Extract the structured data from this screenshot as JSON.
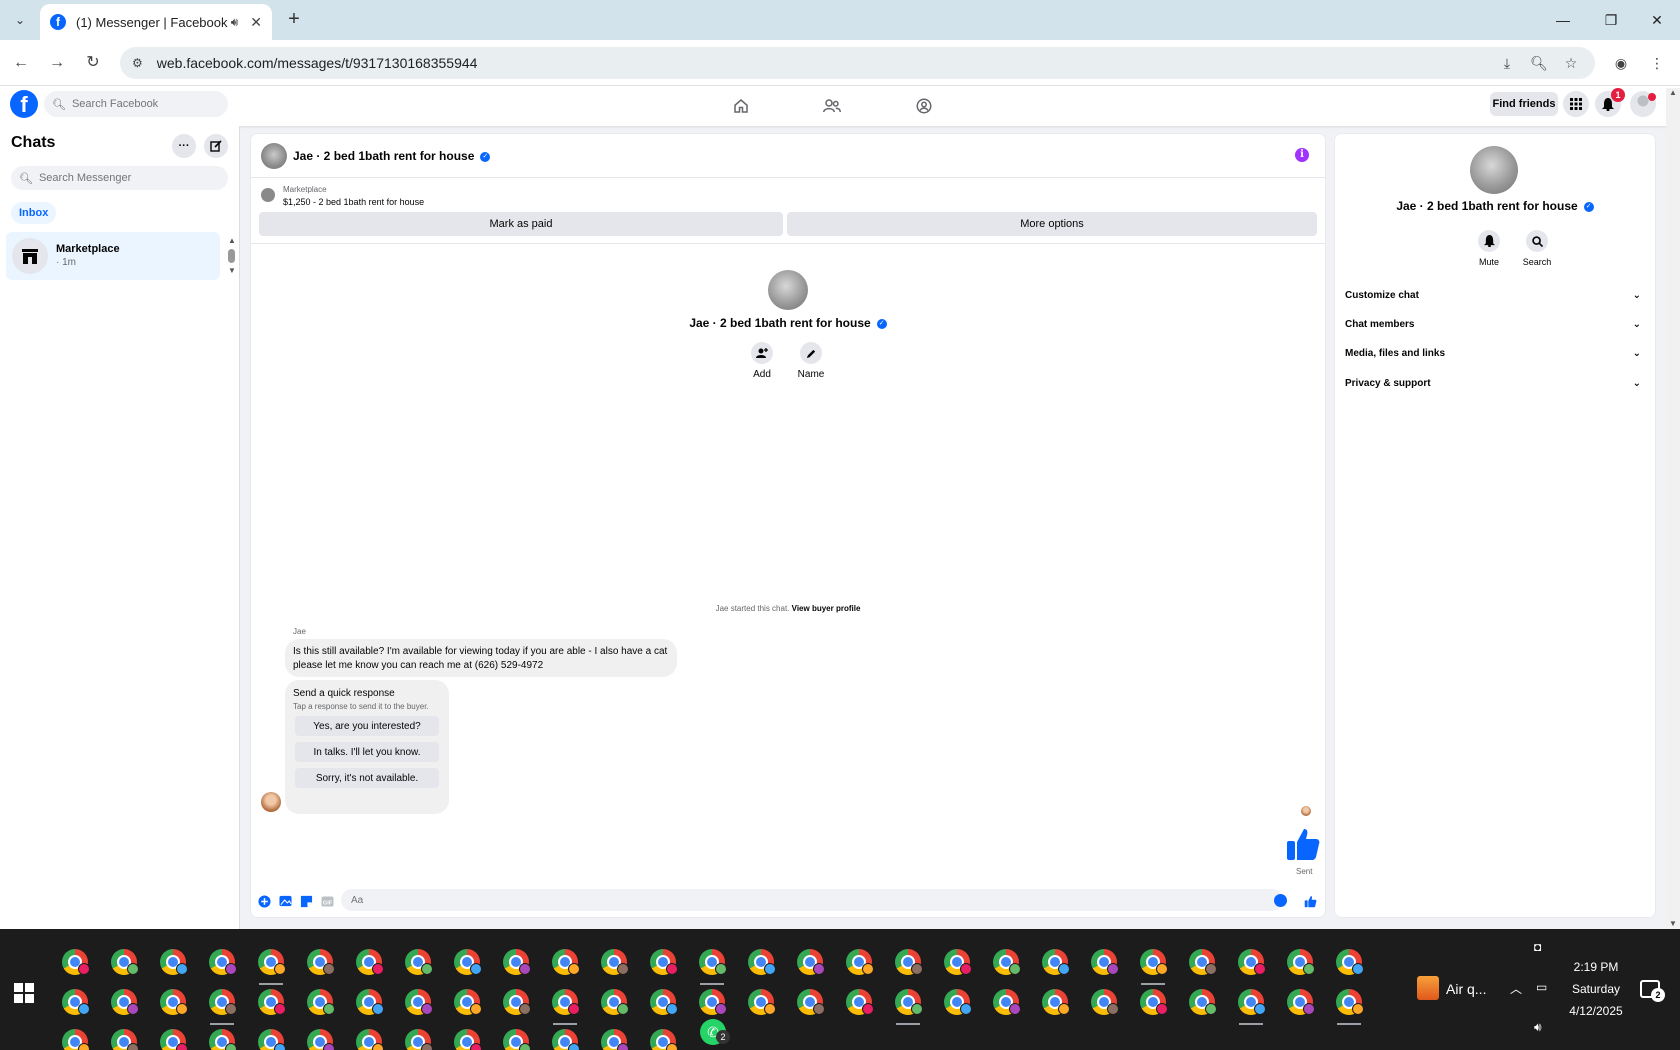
{
  "browser": {
    "tab_title": "(1) Messenger | Facebook",
    "tab_close": "✕",
    "new_tab": "+",
    "url": "web.facebook.com/messages/t/9317130168355944"
  },
  "facebook": {
    "search_placeholder": "Search Facebook",
    "find_friends": "Find friends",
    "notification_count": "1"
  },
  "sidebar": {
    "title": "Chats",
    "more_label": "···",
    "search_placeholder": "Search Messenger",
    "inbox_label": "Inbox",
    "chats": [
      {
        "name": "Marketplace",
        "time": "· 1m"
      }
    ]
  },
  "chat": {
    "title": "Jae · 2 bed 1bath rent for house",
    "marketplace_label": "Marketplace",
    "listing": "$1,250 - 2 bed 1bath rent for house",
    "mark_paid": "Mark as paid",
    "more_options": "More options",
    "intro_name": "Jae · 2 bed 1bath rent for house",
    "add_label": "Add",
    "name_label": "Name",
    "started_text": "Jae started this chat.",
    "view_profile": "View buyer profile",
    "sender": "Jae",
    "message_line1": "Is this still available? I'm available for viewing today if you are able - I also have a cat",
    "message_line2": "please let me know you can reach me at (626) 529-4972",
    "quick_title": "Send a quick response",
    "quick_sub": "Tap a response to send it to the buyer.",
    "quick_responses": [
      "Yes, are you interested?",
      "In talks. I'll let you know.",
      "Sorry, it's not available."
    ],
    "sent_label": "Sent",
    "composer_placeholder": "Aa"
  },
  "info_panel": {
    "name": "Jae · 2 bed 1bath rent for house",
    "mute": "Mute",
    "search": "Search",
    "sections": [
      "Customize chat",
      "Chat members",
      "Media, files and links",
      "Privacy & support"
    ]
  },
  "taskbar": {
    "weather": "Air q...",
    "time": "2:19 PM",
    "day": "Saturday",
    "date": "4/12/2025",
    "whatsapp_count": "2",
    "notifications_count": "2"
  },
  "colors": {
    "facebook_blue": "#0866ff",
    "messenger_purple": "#a033ff",
    "selected_chat_bg": "#ebf5ff",
    "taskbar_bg": "#1c1c1c"
  }
}
